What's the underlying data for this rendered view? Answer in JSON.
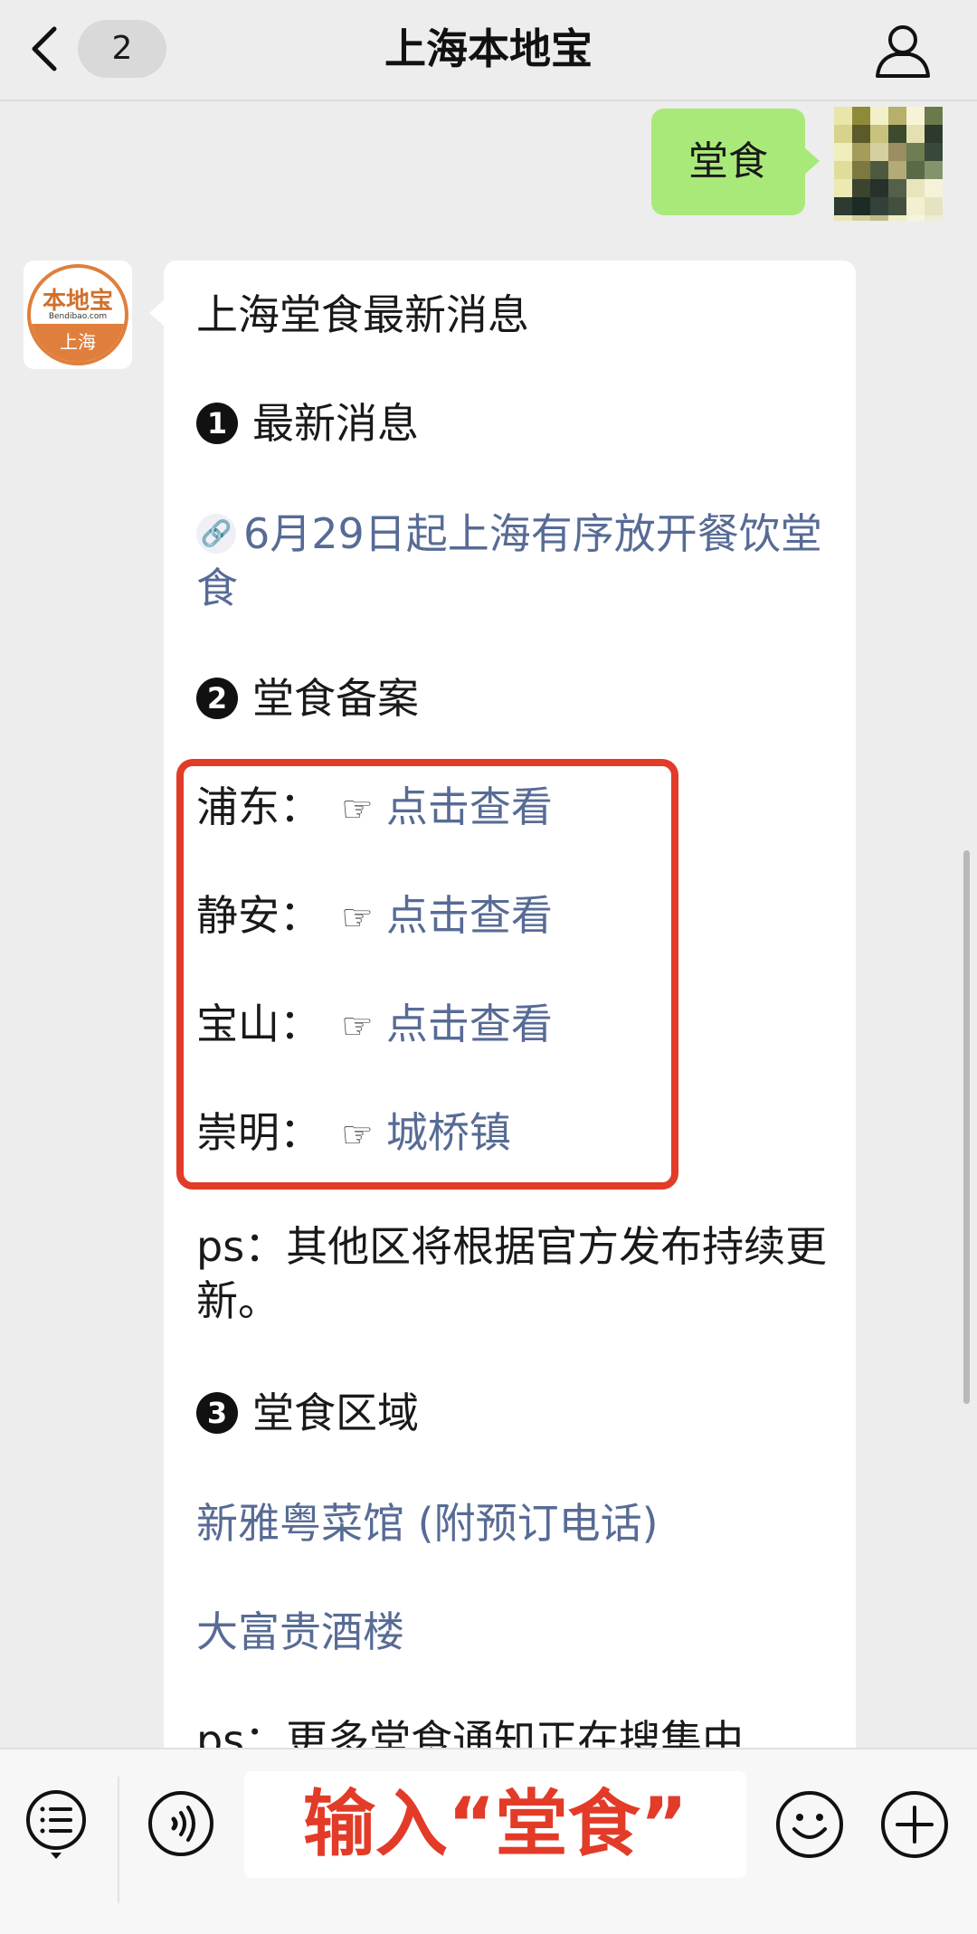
{
  "header": {
    "unread_count": "2",
    "title": "上海本地宝"
  },
  "sent_message": {
    "text": "堂食"
  },
  "account_logo": {
    "main": "本地宝",
    "domain": "Bendibao.com",
    "city": "上海"
  },
  "reply": {
    "title": "上海堂食最新消息",
    "sections": [
      {
        "number": "1",
        "label": "最新消息"
      },
      {
        "number": "2",
        "label": "堂食备案"
      },
      {
        "number": "3",
        "label": "堂食区域"
      }
    ],
    "news_link": "6月29日起上海有序放开餐饮堂食",
    "news_link_icon": "link-icon",
    "districts": [
      {
        "name": "浦东：",
        "link": "点击查看"
      },
      {
        "name": "静安：",
        "link": "点击查看"
      },
      {
        "name": "宝山：",
        "link": "点击查看"
      },
      {
        "name": "崇明：",
        "link": "城桥镇"
      }
    ],
    "pointer": "☞",
    "ps_note": "ps：其他区将根据官方发布持续更新。",
    "restaurants": [
      "新雅粤菜馆 (附预订电话)",
      "大富贵酒楼"
    ],
    "ps_note_2": "ps：更多堂食通知正在搜集中"
  },
  "input": {
    "overlay_text": "输入“堂食”"
  },
  "colors": {
    "background": "#ededed",
    "sent_bubble": "#a9e97a",
    "link": "#576b95",
    "highlight_red": "#e23b28",
    "logo_orange": "#e07f3d"
  },
  "icons": [
    "back-chevron-icon",
    "person-icon",
    "menu-list-icon",
    "voice-icon",
    "emoji-icon",
    "plus-icon",
    "link-icon",
    "pointing-hand-icon"
  ]
}
